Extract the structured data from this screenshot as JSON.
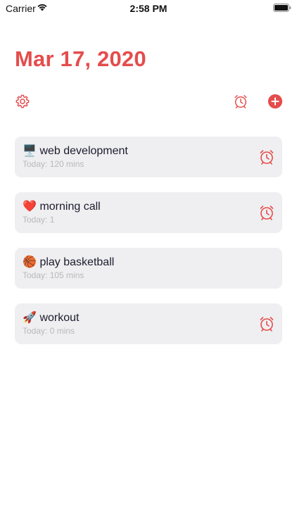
{
  "status_bar": {
    "carrier": "Carrier",
    "time": "2:58 PM"
  },
  "header": {
    "date_title": "Mar 17, 2020"
  },
  "colors": {
    "accent": "#e54c4c",
    "card_bg": "#efeff1",
    "subtitle": "#b8b8bd"
  },
  "toolbar": {
    "settings_icon": "gear-icon",
    "alarm_icon": "alarm-clock-icon",
    "add_icon": "plus-circle-icon"
  },
  "tasks": [
    {
      "emoji": "🖥️",
      "title": "web development",
      "subtitle": "Today: 120 mins",
      "has_alarm": true
    },
    {
      "emoji": "❤️",
      "title": "morning call",
      "subtitle": "Today: 1",
      "has_alarm": true
    },
    {
      "emoji": "🏀",
      "title": "play basketball",
      "subtitle": "Today: 105 mins",
      "has_alarm": false
    },
    {
      "emoji": "🚀",
      "title": "workout",
      "subtitle": "Today: 0 mins",
      "has_alarm": true
    }
  ]
}
